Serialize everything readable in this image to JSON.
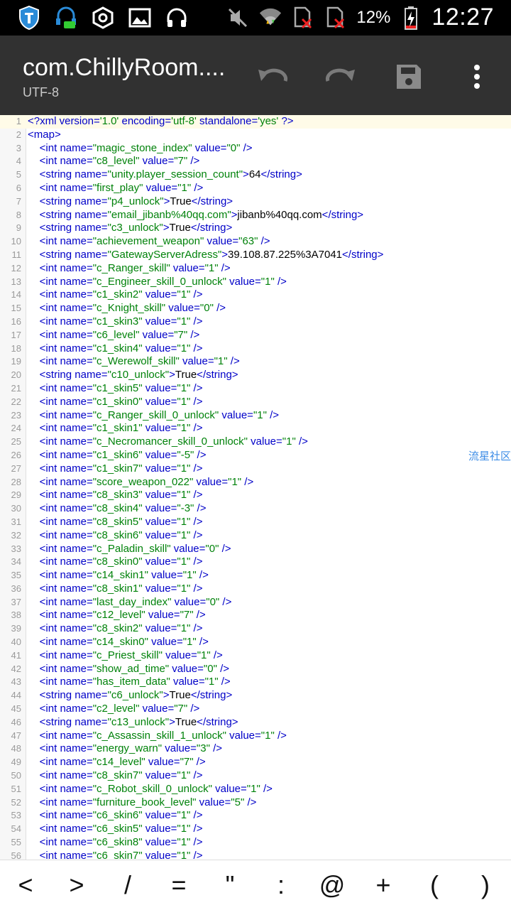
{
  "statusbar": {
    "battery": "12%",
    "time": "12:27",
    "icons": [
      "shield-icon",
      "headset-notif-icon",
      "hexagon-icon",
      "image-icon",
      "headphones-icon",
      "mute-icon",
      "wifi-icon",
      "sim1-icon",
      "sim2-icon",
      "battery-charging-icon"
    ]
  },
  "toolbar": {
    "title": "com.ChillyRoom....",
    "encoding": "UTF-8",
    "actions": [
      "undo-icon",
      "redo-icon",
      "save-icon",
      "overflow-menu-icon"
    ]
  },
  "editor": {
    "lines": [
      {
        "n": "1",
        "t": "<?xml version='1.0' encoding='utf-8' standalone='yes' ?>"
      },
      {
        "n": "2",
        "t": "<map>"
      },
      {
        "n": "3",
        "t": "    <int name=\"magic_stone_index\" value=\"0\" />"
      },
      {
        "n": "4",
        "t": "    <int name=\"c8_level\" value=\"7\" />"
      },
      {
        "n": "5",
        "t": "    <string name=\"unity.player_session_count\">64</string>"
      },
      {
        "n": "6",
        "t": "    <int name=\"first_play\" value=\"1\" />"
      },
      {
        "n": "7",
        "t": "    <string name=\"p4_unlock\">True</string>"
      },
      {
        "n": "8",
        "t": "    <string name=\"email_jibanb%40qq.com\">jibanb%40qq.com</string>"
      },
      {
        "n": "9",
        "t": "    <string name=\"c3_unlock\">True</string>"
      },
      {
        "n": "10",
        "t": "    <int name=\"achievement_weapon\" value=\"63\" />"
      },
      {
        "n": "11",
        "t": "    <string name=\"GatewayServerAdress\">39.108.87.225%3A7041</string>"
      },
      {
        "n": "12",
        "t": "    <int name=\"c_Ranger_skill\" value=\"1\" />"
      },
      {
        "n": "13",
        "t": "    <int name=\"c_Engineer_skill_0_unlock\" value=\"1\" />"
      },
      {
        "n": "14",
        "t": "    <int name=\"c1_skin2\" value=\"1\" />"
      },
      {
        "n": "15",
        "t": "    <int name=\"c_Knight_skill\" value=\"0\" />"
      },
      {
        "n": "16",
        "t": "    <int name=\"c1_skin3\" value=\"1\" />"
      },
      {
        "n": "17",
        "t": "    <int name=\"c6_level\" value=\"7\" />"
      },
      {
        "n": "18",
        "t": "    <int name=\"c1_skin4\" value=\"1\" />"
      },
      {
        "n": "19",
        "t": "    <int name=\"c_Werewolf_skill\" value=\"1\" />"
      },
      {
        "n": "20",
        "t": "    <string name=\"c10_unlock\">True</string>"
      },
      {
        "n": "21",
        "t": "    <int name=\"c1_skin5\" value=\"1\" />"
      },
      {
        "n": "22",
        "t": "    <int name=\"c1_skin0\" value=\"1\" />"
      },
      {
        "n": "23",
        "t": "    <int name=\"c_Ranger_skill_0_unlock\" value=\"1\" />"
      },
      {
        "n": "24",
        "t": "    <int name=\"c1_skin1\" value=\"1\" />"
      },
      {
        "n": "25",
        "t": "    <int name=\"c_Necromancer_skill_0_unlock\" value=\"1\" />"
      },
      {
        "n": "26",
        "t": "    <int name=\"c1_skin6\" value=\"-5\" />"
      },
      {
        "n": "27",
        "t": "    <int name=\"c1_skin7\" value=\"1\" />"
      },
      {
        "n": "28",
        "t": "    <int name=\"score_weapon_022\" value=\"1\" />"
      },
      {
        "n": "29",
        "t": "    <int name=\"c8_skin3\" value=\"1\" />"
      },
      {
        "n": "30",
        "t": "    <int name=\"c8_skin4\" value=\"-3\" />"
      },
      {
        "n": "31",
        "t": "    <int name=\"c8_skin5\" value=\"1\" />"
      },
      {
        "n": "32",
        "t": "    <int name=\"c8_skin6\" value=\"1\" />"
      },
      {
        "n": "33",
        "t": "    <int name=\"c_Paladin_skill\" value=\"0\" />"
      },
      {
        "n": "34",
        "t": "    <int name=\"c8_skin0\" value=\"1\" />"
      },
      {
        "n": "35",
        "t": "    <int name=\"c14_skin1\" value=\"1\" />"
      },
      {
        "n": "36",
        "t": "    <int name=\"c8_skin1\" value=\"1\" />"
      },
      {
        "n": "37",
        "t": "    <int name=\"last_day_index\" value=\"0\" />"
      },
      {
        "n": "38",
        "t": "    <int name=\"c12_level\" value=\"7\" />"
      },
      {
        "n": "39",
        "t": "    <int name=\"c8_skin2\" value=\"1\" />"
      },
      {
        "n": "40",
        "t": "    <int name=\"c14_skin0\" value=\"1\" />"
      },
      {
        "n": "41",
        "t": "    <int name=\"c_Priest_skill\" value=\"1\" />"
      },
      {
        "n": "42",
        "t": "    <int name=\"show_ad_time\" value=\"0\" />"
      },
      {
        "n": "43",
        "t": "    <int name=\"has_item_data\" value=\"1\" />"
      },
      {
        "n": "44",
        "t": "    <string name=\"c6_unlock\">True</string>"
      },
      {
        "n": "45",
        "t": "    <int name=\"c2_level\" value=\"7\" />"
      },
      {
        "n": "46",
        "t": "    <string name=\"c13_unlock\">True</string>"
      },
      {
        "n": "47",
        "t": "    <int name=\"c_Assassin_skill_1_unlock\" value=\"1\" />"
      },
      {
        "n": "48",
        "t": "    <int name=\"energy_warn\" value=\"3\" />"
      },
      {
        "n": "49",
        "t": "    <int name=\"c14_level\" value=\"7\" />"
      },
      {
        "n": "50",
        "t": "    <int name=\"c8_skin7\" value=\"1\" />"
      },
      {
        "n": "51",
        "t": "    <int name=\"c_Robot_skill_0_unlock\" value=\"1\" />"
      },
      {
        "n": "52",
        "t": "    <int name=\"furniture_book_level\" value=\"5\" />"
      },
      {
        "n": "53",
        "t": "    <int name=\"c6_skin6\" value=\"1\" />"
      },
      {
        "n": "54",
        "t": "    <int name=\"c6_skin5\" value=\"1\" />"
      },
      {
        "n": "55",
        "t": "    <int name=\"c6_skin8\" value=\"1\" />"
      },
      {
        "n": "56",
        "t": "    <int name=\"c6_skin7\" value=\"1\" />"
      }
    ],
    "watermark": "流星社区"
  },
  "symbol_keys": [
    "<",
    ">",
    "/",
    "=",
    "\"",
    ":",
    "@",
    "+",
    "(",
    ")"
  ],
  "colors": {
    "tag": "#0000c8",
    "value": "#00820a",
    "text": "#000000",
    "toolbar": "#313131"
  }
}
